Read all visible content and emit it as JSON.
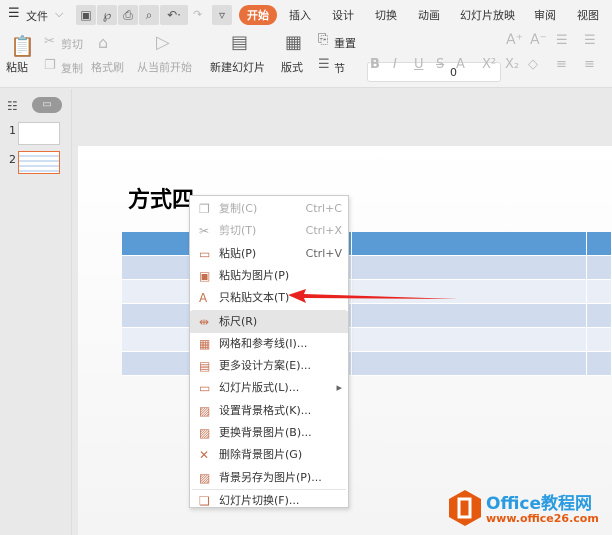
{
  "topbar": {
    "menu_icon": "hamburger-icon",
    "file": "文件",
    "tabs": [
      "开始",
      "插入",
      "设计",
      "切换",
      "动画",
      "幻灯片放映",
      "审阅",
      "视图"
    ],
    "active_tab": "开始",
    "accent": "#e8703a"
  },
  "ribbon": {
    "paste": "粘贴",
    "cut": "剪切",
    "copy": "复制",
    "format_painter": "格式刷",
    "play_from_current": "从当前开始",
    "new_slide": "新建幻灯片",
    "layout": "版式",
    "reset": "重置",
    "section": "节",
    "font_size": "0"
  },
  "slides": {
    "numbers": [
      "1",
      "2"
    ],
    "selected": "2"
  },
  "slide": {
    "title": "方式四",
    "table_header_color": "#5b9bd5",
    "table_row_color": "#d0dbee"
  },
  "menu": {
    "items": [
      {
        "label": "复制(C)",
        "shortcut": "Ctrl+C",
        "icon": "copy-icon",
        "disabled": true
      },
      {
        "label": "剪切(T)",
        "shortcut": "Ctrl+X",
        "icon": "scissors-icon",
        "disabled": true
      },
      {
        "label": "粘贴(P)",
        "shortcut": "Ctrl+V",
        "icon": "paste-icon"
      },
      {
        "label": "粘贴为图片(P)",
        "shortcut": "",
        "icon": "paste-picture-icon"
      },
      {
        "label": "只粘贴文本(T)",
        "shortcut": "",
        "icon": "paste-text-icon"
      },
      {
        "label": "标尺(R)",
        "shortcut": "",
        "icon": "ruler-icon"
      },
      {
        "label": "网格和参考线(I)...",
        "shortcut": "",
        "icon": "grid-icon"
      },
      {
        "label": "更多设计方案(E)...",
        "shortcut": "",
        "icon": "design-icon"
      },
      {
        "label": "幻灯片版式(L)...",
        "shortcut": "▸",
        "icon": "layout-icon"
      },
      {
        "label": "设置背景格式(K)...",
        "shortcut": "",
        "icon": "background-format-icon"
      },
      {
        "label": "更换背景图片(B)...",
        "shortcut": "",
        "icon": "replace-background-icon"
      },
      {
        "label": "删除背景图片(G)",
        "shortcut": "",
        "icon": "delete-background-icon"
      },
      {
        "label": "背景另存为图片(P)...",
        "shortcut": "",
        "icon": "save-background-icon"
      },
      {
        "label": "幻灯片切换(F)...",
        "shortcut": "",
        "icon": "transition-icon"
      }
    ]
  },
  "watermark": {
    "brand": "Office教程网",
    "url": "www.office26.com"
  }
}
